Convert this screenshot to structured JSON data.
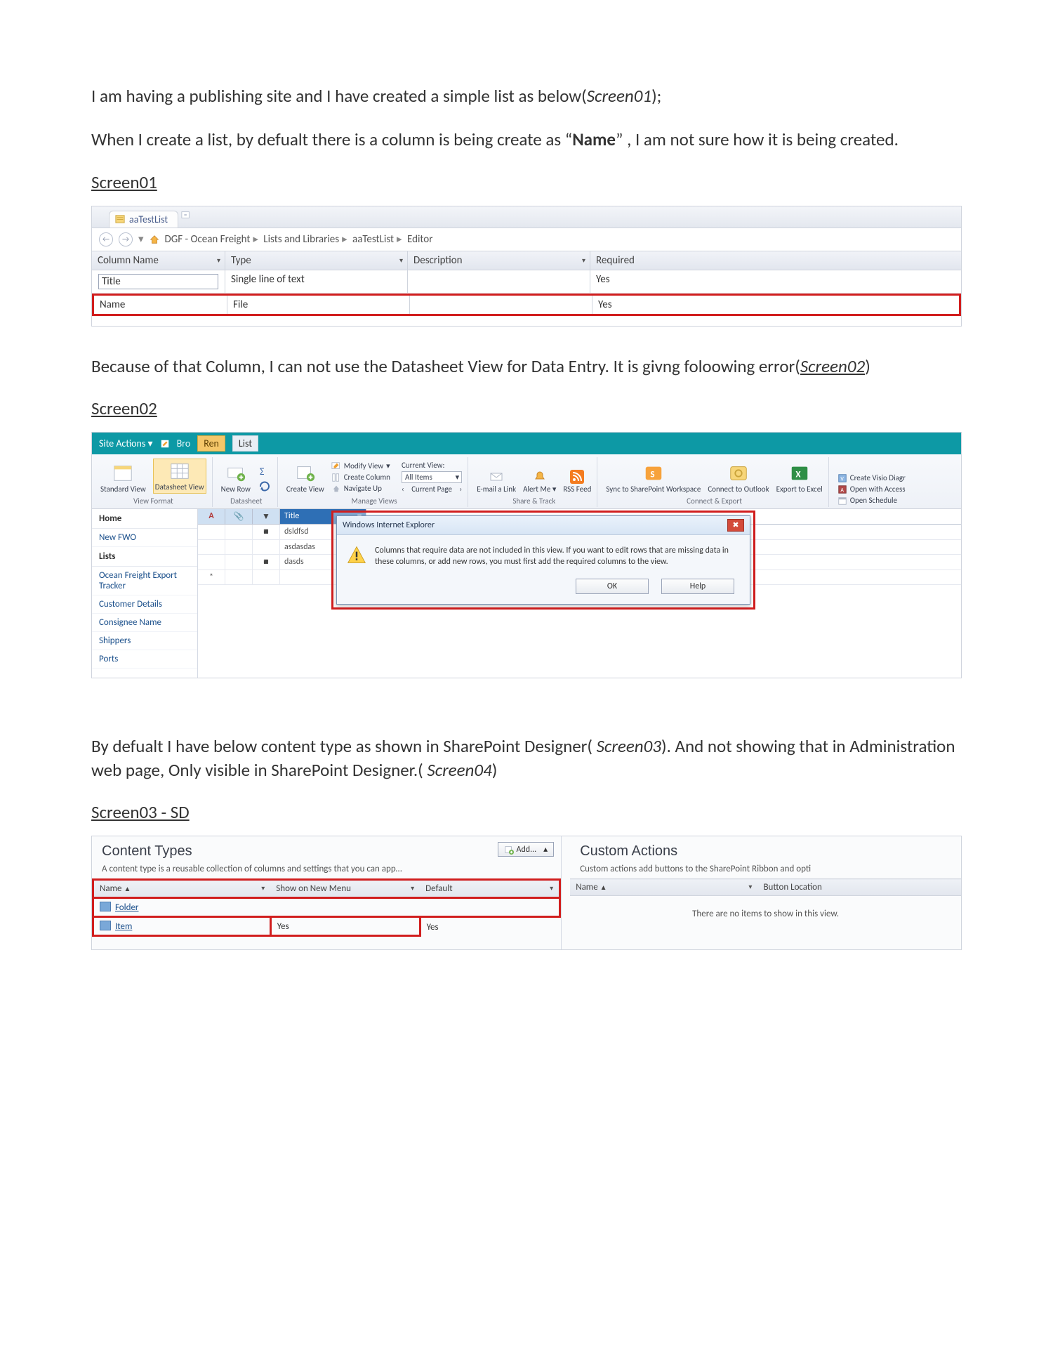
{
  "para1_a": "I am having a publishing site and I have created a simple list as below(",
  "para1_b": "Screen01",
  "para1_c": ");",
  "para2_a": "When I create a list, by defualt there is a column is being create as “",
  "para2_b": "Name",
  "para2_c": "” , I am not sure how it is being created.",
  "label_s1": "Screen01",
  "s1_tab": "aaTestList",
  "s1_crumb": [
    "DGF - Ocean Freight",
    "Lists and Libraries",
    "aaTestList",
    "Editor"
  ],
  "s1_cols": [
    "Column Name",
    "Type",
    "Description",
    "Required"
  ],
  "s1_rows": [
    {
      "name": "Title",
      "type": "Single line of text",
      "desc": "",
      "req": "Yes"
    },
    {
      "name": "Name",
      "type": "File",
      "desc": "",
      "req": "Yes"
    }
  ],
  "para3_a": "Because of that Column, I can not use the Datasheet View  for Data Entry. It is givng foloowing error(",
  "para3_b": "Screen02",
  "para3_c": ")",
  "label_s2": "Screen02",
  "s2_siteactions": "Site Actions",
  "s2_tab_ren": "Ren",
  "s2_tab_list": "List",
  "s2_tab_bro": "Bro",
  "ribbon": {
    "standard": "Standard View",
    "datasheet": "Datasheet View",
    "newrow": "New Row",
    "viewformat": "View Format",
    "datasheet_grp": "Datasheet",
    "create": "Create View",
    "modify": "Modify View",
    "createcol": "Create Column",
    "navup": "Navigate Up",
    "curviewlbl": "Current View:",
    "curview": "All Items",
    "curpage": "Current Page",
    "manage": "Manage Views",
    "email": "E-mail a Link",
    "alert": "Alert Me",
    "rss": "RSS Feed",
    "share": "Share & Track",
    "sync": "Sync to SharePoint Workspace",
    "outlook": "Connect to Outlook",
    "excel": "Export to Excel",
    "connect": "Connect & Export",
    "visio": "Create Visio Diagr",
    "access": "Open with Access",
    "schedule": "Open Schedule"
  },
  "s2_nav": {
    "home": "Home",
    "newfwo": "New FWO",
    "lists": "Lists",
    "tracker": "Ocean Freight Export Tracker",
    "cust": "Customer Details",
    "cons": "Consignee Name",
    "ship": "Shippers",
    "ports": "Ports"
  },
  "s2_sheetcol": "Title",
  "s2_rows": [
    "dsldfsd",
    "asdasdas",
    "dasds"
  ],
  "dlg_title": "Windows Internet Explorer",
  "dlg_msg": "Columns that require data are not included in this view. If you want to edit rows that are missing data in these columns, or add new rows, you must first add the required columns to the view.",
  "dlg_ok": "OK",
  "dlg_help": "Help",
  "para4_a": "By defualt I have below content type as shown in SharePoint Designer( ",
  "para4_b": "Screen03",
  "para4_c": "). And not showing that in Administration web page, Only visible in SharePoint Designer.( ",
  "para4_d": "Screen04",
  "para4_e": ")",
  "label_s3": "Screen03 - SD",
  "s3_left_h": "Content Types",
  "s3_left_sub": "A content type is a reusable collection of columns and settings that you can app…",
  "s3_add": "Add...",
  "s3_cols": [
    "Name",
    "Show on New Menu",
    "Default"
  ],
  "s3_rows": [
    {
      "name": "Folder",
      "show": "",
      "def": ""
    },
    {
      "name": "Item",
      "show": "Yes",
      "def": "Yes"
    }
  ],
  "s3_right_h": "Custom Actions",
  "s3_right_sub": "Custom actions add buttons to the SharePoint Ribbon and opti",
  "s3_right_cols": [
    "Name",
    "Button Location"
  ],
  "s3_empty": "There are no items to show in this view."
}
